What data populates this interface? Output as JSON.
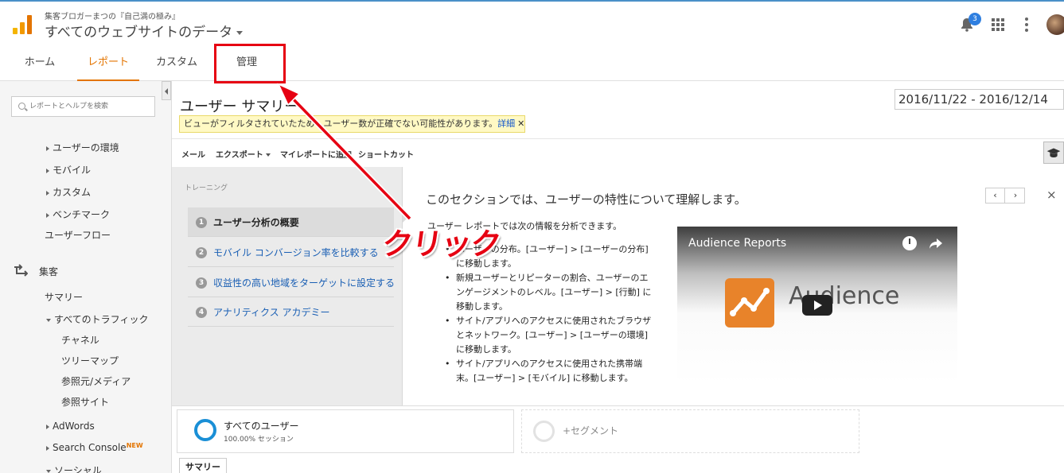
{
  "header": {
    "account_name": "集客ブロガーまつの『自己満の極み』",
    "property_name": "すべてのウェブサイトのデータ",
    "notification_count": "3"
  },
  "nav": {
    "tabs": [
      {
        "label": "ホーム"
      },
      {
        "label": "レポート",
        "active": true
      },
      {
        "label": "カスタム"
      },
      {
        "label": "管理"
      }
    ]
  },
  "sidebar": {
    "search_placeholder": "レポートとヘルプを検索",
    "items": [
      {
        "label": "ユーザーの環境"
      },
      {
        "label": "モバイル"
      },
      {
        "label": "カスタム"
      },
      {
        "label": "ベンチマーク"
      },
      {
        "label": "ユーザーフロー"
      },
      {
        "label": "集客"
      },
      {
        "label": "サマリー"
      },
      {
        "label": "すべてのトラフィック"
      },
      {
        "label": "チャネル"
      },
      {
        "label": "ツリーマップ"
      },
      {
        "label": "参照元/メディア"
      },
      {
        "label": "参照サイト"
      },
      {
        "label": "AdWords"
      },
      {
        "label": "Search Console"
      },
      {
        "label": "ソーシャル"
      }
    ],
    "new_tag": "NEW"
  },
  "main": {
    "title": "ユーザー サマリー",
    "date_start": "2016/11/22",
    "date_sep": " - ",
    "date_end": "2016/12/14",
    "warning": "ビューがフィルタされていたため、ユーザー数が正確でない可能性があります。",
    "warning_link": "詳細",
    "toolbar": [
      "メール",
      "エクスポート",
      "マイレポートに追加",
      "ショートカット"
    ]
  },
  "training": {
    "header": "トレーニング",
    "items": [
      {
        "num": "1",
        "label": "ユーザー分析の概要"
      },
      {
        "num": "2",
        "label": "モバイル コンバージョン率を比較する"
      },
      {
        "num": "3",
        "label": "収益性の高い地域をターゲットに設定する"
      },
      {
        "num": "4",
        "label": "アナリティクス アカデミー"
      }
    ],
    "section_title": "このセクションでは、ユーザーの特性について理解します。",
    "intro": "ユーザー レポートでは次の情報を分析できます。",
    "lines": [
      "ユーザーの分布。[ユーザー] > [ユーザーの分布]",
      "に移動します。",
      "新規ユーザーとリピーターの割合、ユーザーのエ",
      "ンゲージメントのレベル。[ユーザー] > [行動] に",
      "移動します。",
      "サイト/アプリへのアクセスに使用されたブラウザ",
      "とネットワーク。[ユーザー] > [ユーザーの環境]",
      "に移動します。",
      "サイト/アプリへのアクセスに使用された携帯端",
      "末。[ユーザー] > [モバイル] に移動します。"
    ],
    "nav_prev": "‹",
    "nav_next": "›",
    "close": "×",
    "video_title": "Audience Reports",
    "video_logo_text": "Audience"
  },
  "segments": {
    "all_users": "すべてのユーザー",
    "all_users_sub": "100.00% セッション",
    "add_segment": "+セグメント",
    "summary_tab": "サマリー"
  },
  "annotation": {
    "label": "クリック",
    "color": "#e60012"
  }
}
